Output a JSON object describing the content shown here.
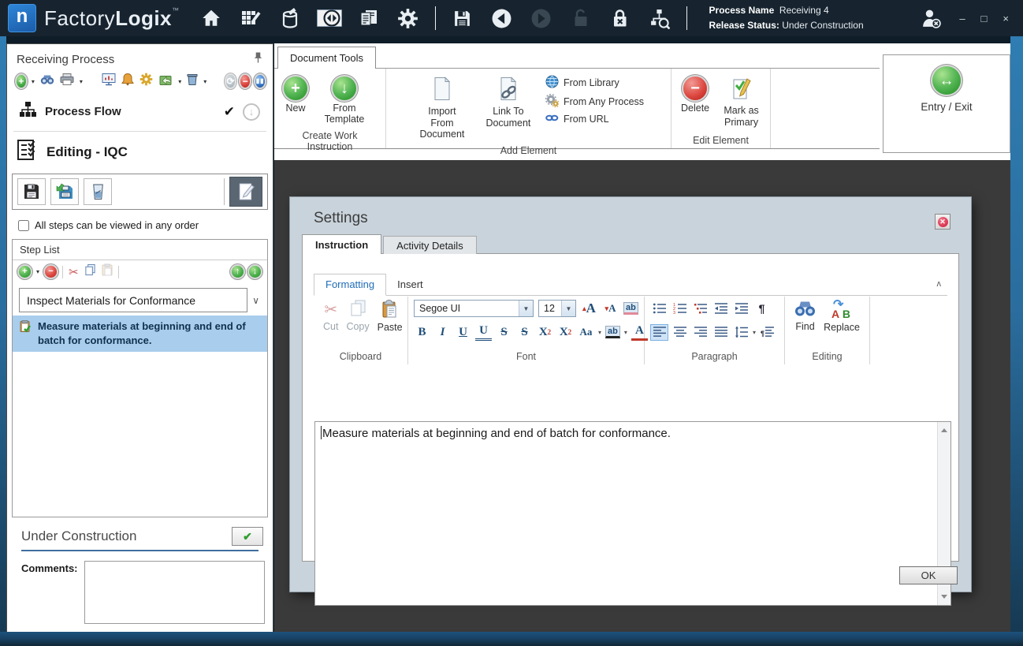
{
  "titlebar": {
    "logo_letter": "n",
    "brand_factory": "Factory",
    "brand_logix": "Logix",
    "trademark": "™",
    "process_name_label": "Process Name",
    "process_name_value": "Receiving 4",
    "release_status_label": "Release Status:",
    "release_status_value": "Under Construction",
    "window_controls": {
      "minimize": "–",
      "maximize": "□",
      "close": "×"
    }
  },
  "left_panel": {
    "title": "Receiving Process",
    "process_flow_label": "Process Flow",
    "process_flow_check": "✔",
    "stage_label": "Editing - IQC",
    "any_order_label": "All steps can be viewed in any order",
    "step_list": {
      "header": "Step List",
      "step_name": "Inspect Materials for Conformance",
      "selected_step_text": "Measure materials at beginning and end of batch for conformance."
    },
    "status_heading": "Under Construction",
    "status_check": "✔",
    "comments_label": "Comments:"
  },
  "ribbon": {
    "tab_label": "Document Tools",
    "create_group": {
      "label": "Create Work Instruction",
      "new": "New",
      "from_template": "From Template"
    },
    "add_group": {
      "label": "Add Element",
      "import": "Import From Document",
      "link": "Link To Document",
      "from_library": "From Library",
      "from_any_process": "From Any Process",
      "from_url": "From URL"
    },
    "edit_group": {
      "label": "Edit Element",
      "delete": "Delete",
      "mark_primary": "Mark as Primary"
    },
    "entry_exit_label": "Entry / Exit"
  },
  "dialog": {
    "title": "Settings",
    "tabs": {
      "instruction": "Instruction",
      "activity_details": "Activity Details"
    },
    "editor_tabs": {
      "formatting": "Formatting",
      "insert": "Insert"
    },
    "clipboard_group": {
      "label": "Clipboard",
      "cut": "Cut",
      "copy": "Copy",
      "paste": "Paste"
    },
    "font_group": {
      "label": "Font",
      "family": "Segoe UI",
      "size": "12",
      "buttons": {
        "bold": "B",
        "italic": "I",
        "underline": "U",
        "double_underline": "U",
        "strikethrough": "S",
        "double_strikethrough": "S",
        "superscript_x": "X",
        "superscript_digit": "2",
        "subscript_x": "X",
        "subscript_digit": "2",
        "change_case": "Aa",
        "highlight": "ab",
        "font_color": "A",
        "grow_font": "A",
        "shrink_font": "A",
        "clear_format": "ab"
      }
    },
    "paragraph_group": {
      "label": "Paragraph",
      "pilcrow": "¶"
    },
    "editing_group": {
      "label": "Editing",
      "find": "Find",
      "replace": "Replace",
      "replace_a": "A",
      "replace_b": "B"
    },
    "editor_text": "Measure materials at beginning and end of batch for conformance.",
    "ok_label": "OK"
  },
  "colors": {
    "titlebar_bg": "#17242f",
    "accent_blue": "#1f6db8",
    "dialog_bg": "#c9d3db",
    "selected_step_bg": "#a9cdec",
    "backdrop": "#3a3a3a",
    "green": "#3fa43f",
    "red": "#d23a3a"
  }
}
